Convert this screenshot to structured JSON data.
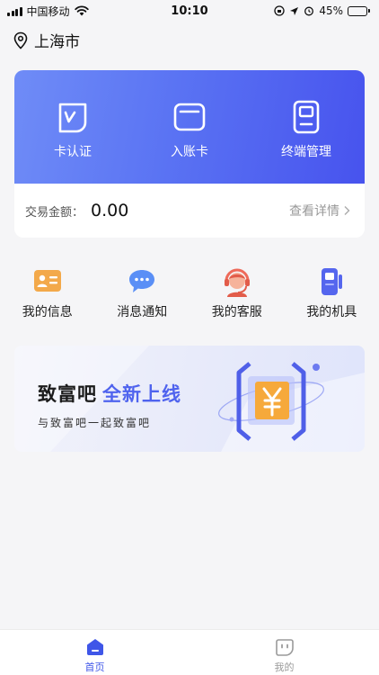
{
  "status_bar": {
    "carrier": "中国移动",
    "time": "10:10",
    "battery": "45%",
    "battery_level": 0.45
  },
  "location": {
    "city": "上海市"
  },
  "card": {
    "functions": [
      {
        "label": "卡认证",
        "icon": "card-verify-icon"
      },
      {
        "label": "入账卡",
        "icon": "deposit-card-icon"
      },
      {
        "label": "终端管理",
        "icon": "terminal-icon"
      }
    ],
    "amount_label": "交易金额：",
    "amount_value": "0.00",
    "detail_label": "查看详情"
  },
  "quick_menu": [
    {
      "label": "我的信息",
      "icon": "id-card-icon"
    },
    {
      "label": "消息通知",
      "icon": "message-icon"
    },
    {
      "label": "我的客服",
      "icon": "customer-service-icon"
    },
    {
      "label": "我的机具",
      "icon": "pos-device-icon"
    }
  ],
  "banner": {
    "title": "致富吧",
    "highlight": "全新上线",
    "subtitle": "与致富吧一起致富吧"
  },
  "tabbar": [
    {
      "label": "首页",
      "icon": "home-icon",
      "active": true
    },
    {
      "label": "我的",
      "icon": "profile-icon",
      "active": false
    }
  ],
  "colors": {
    "accent": "#4f63ee",
    "card_gradient_start": "#6f8cf7",
    "card_gradient_end": "#4753ee"
  }
}
